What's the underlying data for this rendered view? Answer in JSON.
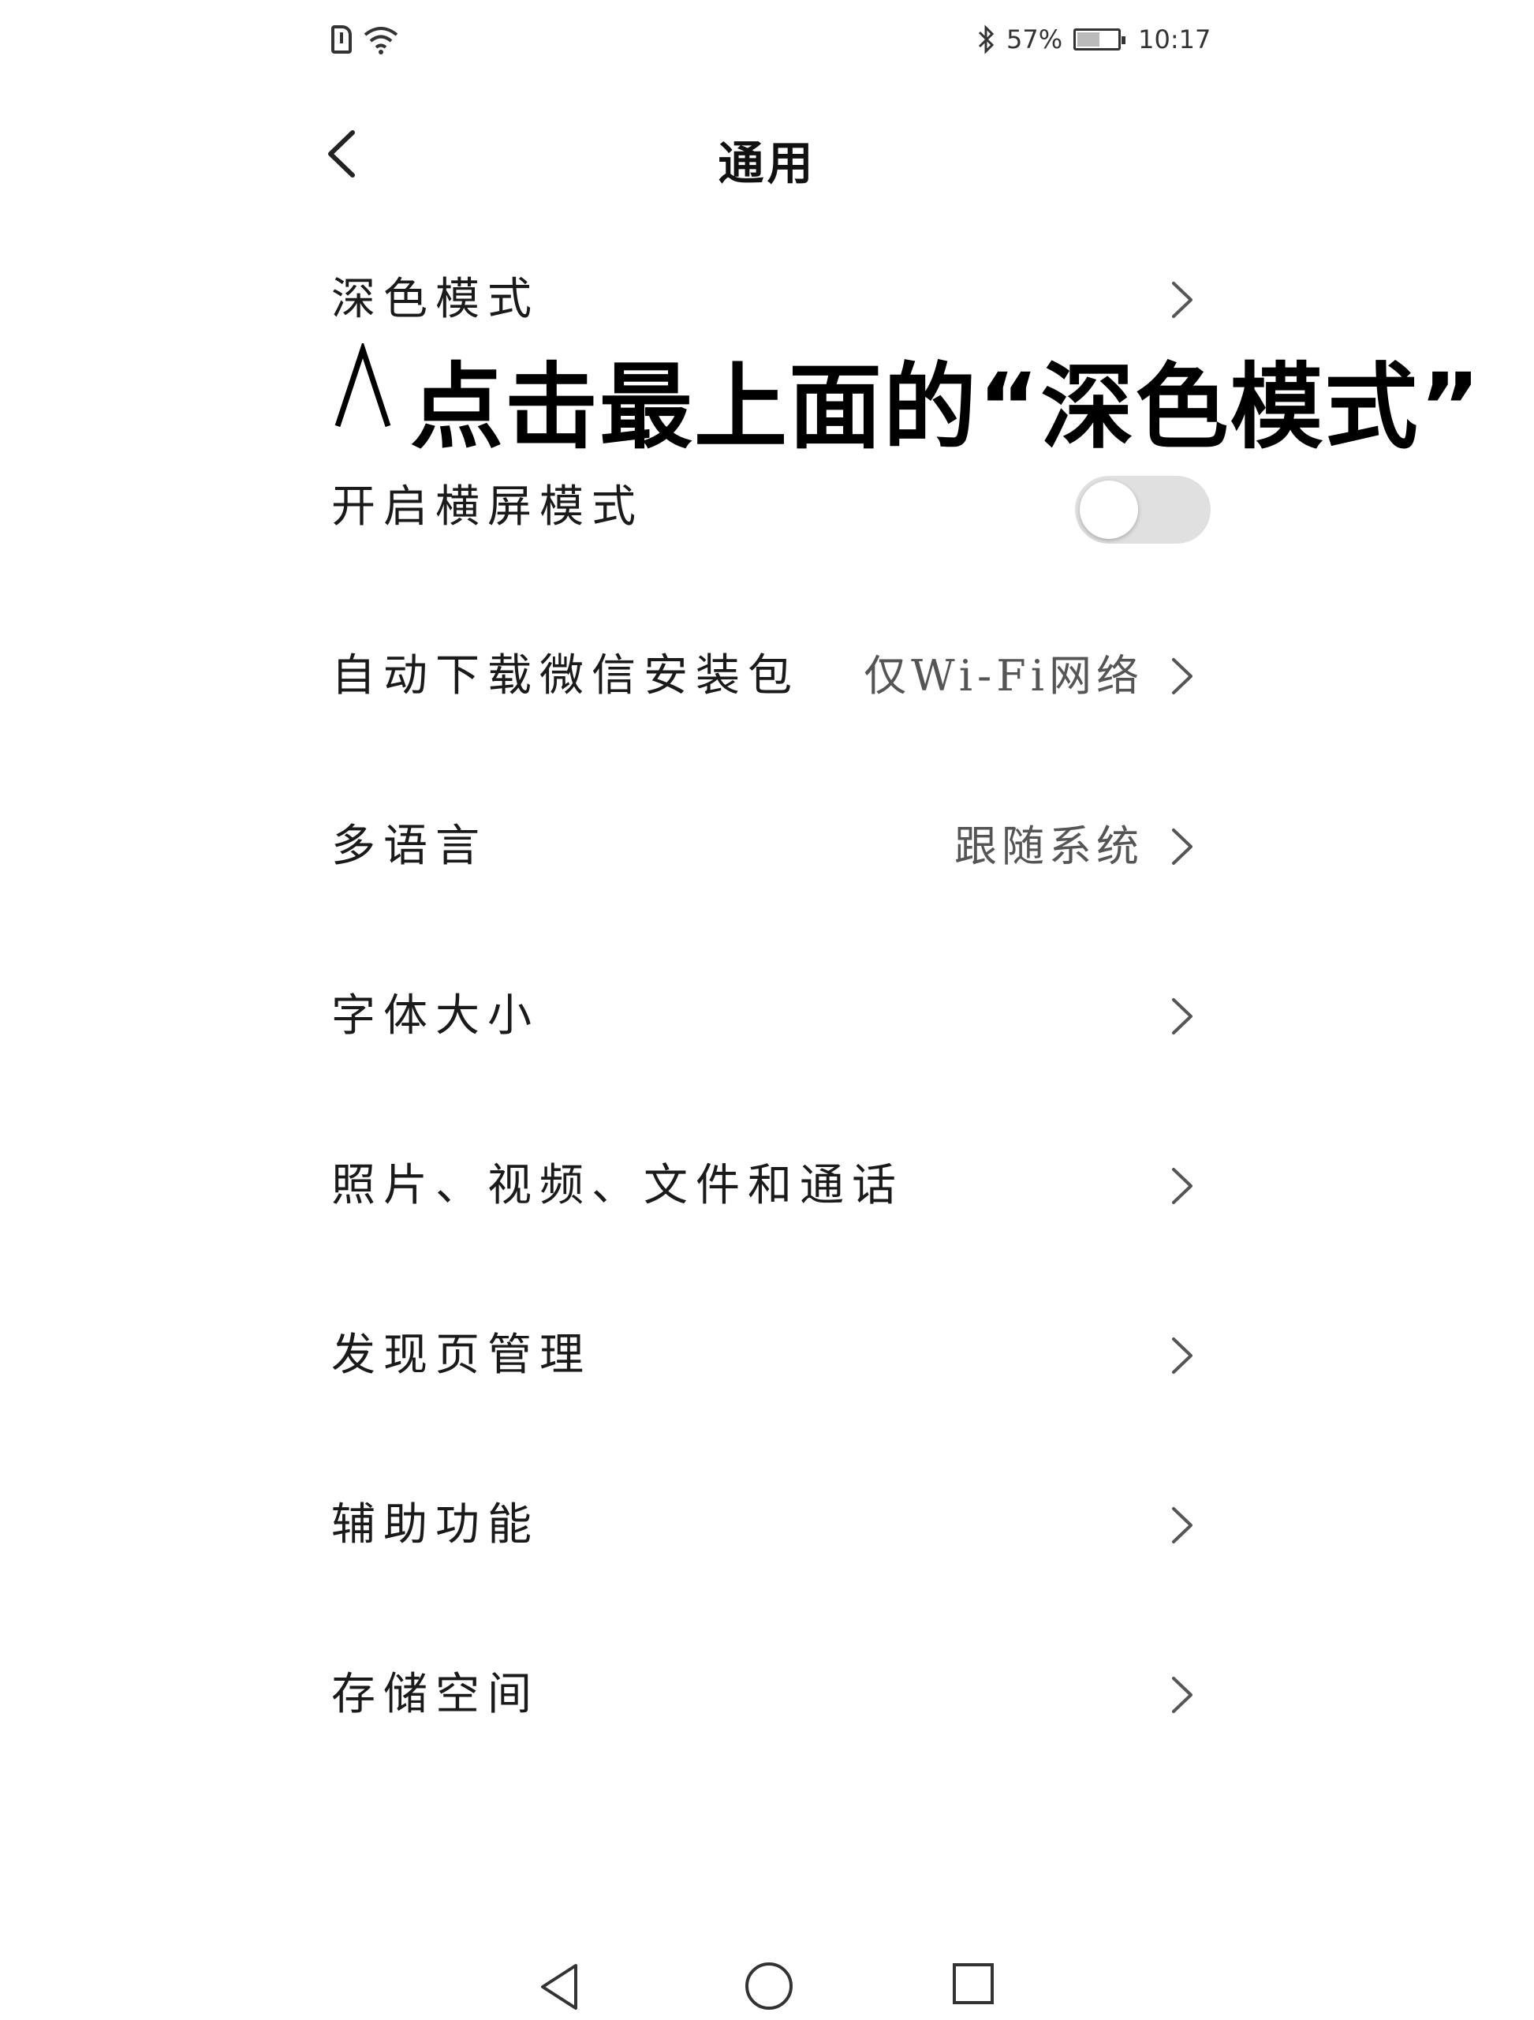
{
  "status_bar": {
    "bluetooth_icon": "bluetooth-icon",
    "battery_percent": "57%",
    "battery_level": 0.57,
    "time": "10:17"
  },
  "header": {
    "title": "通用"
  },
  "settings": {
    "dark_mode": {
      "label": "深色模式"
    },
    "landscape": {
      "label": "开启横屏模式",
      "enabled": false
    },
    "auto_download": {
      "label": "自动下载微信安装包",
      "value": "仅Wi-Fi网络"
    },
    "language": {
      "label": "多语言",
      "value": "跟随系统"
    },
    "font_size": {
      "label": "字体大小"
    },
    "media": {
      "label": "照片、视频、文件和通话"
    },
    "discover": {
      "label": "发现页管理"
    },
    "accessibility": {
      "label": "辅助功能"
    },
    "storage": {
      "label": "存储空间"
    }
  },
  "overlay": {
    "caption": "点击最上面的“深色模式”"
  },
  "colors": {
    "toggle_off": "#e0e0e0",
    "text": "#1a1a1a",
    "secondary_text": "#555555"
  }
}
